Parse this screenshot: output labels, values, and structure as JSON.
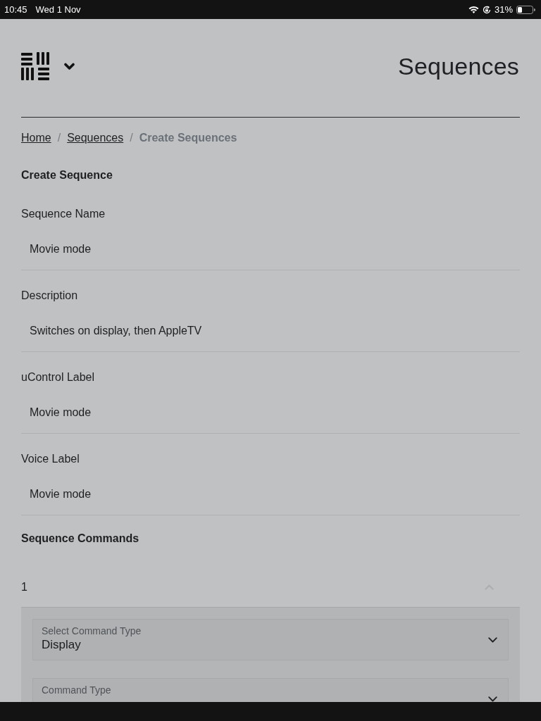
{
  "status_bar": {
    "time": "10:45",
    "date": "Wed 1 Nov",
    "battery_percent": "31%"
  },
  "header": {
    "title": "Sequences"
  },
  "breadcrumb": {
    "items": [
      {
        "label": "Home",
        "kind": "link"
      },
      {
        "label": "Sequences",
        "kind": "link"
      },
      {
        "label": "Create Sequences",
        "kind": "current"
      }
    ],
    "separators": [
      "/",
      "/"
    ]
  },
  "form": {
    "title": "Create Sequence",
    "fields": [
      {
        "label": "Sequence Name",
        "value": "Movie mode"
      },
      {
        "label": "Description",
        "value": "Switches on display, then AppleTV"
      },
      {
        "label": "uControl Label",
        "value": "Movie mode"
      },
      {
        "label": "Voice Label",
        "value": "Movie mode"
      }
    ]
  },
  "commands": {
    "title": "Sequence Commands",
    "items": [
      {
        "number": "1",
        "expanded": true,
        "fields": [
          {
            "label": "Select Command Type",
            "value": "Display"
          },
          {
            "label": "Command Type"
          }
        ]
      }
    ]
  }
}
